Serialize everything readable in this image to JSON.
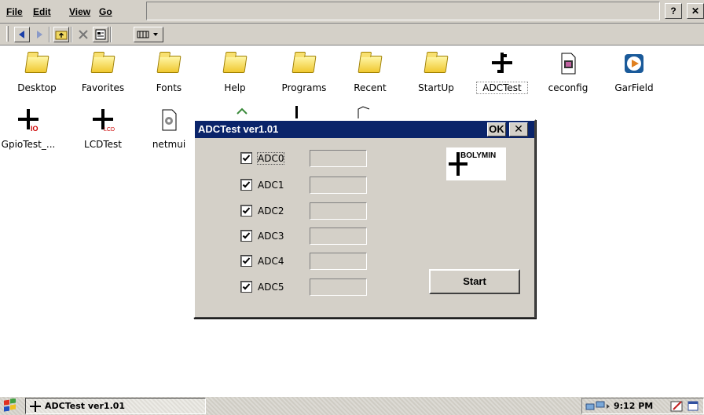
{
  "menubar": {
    "items": [
      "File",
      "Edit",
      "View",
      "Go"
    ],
    "help_label": "?",
    "close_label": "✕"
  },
  "toolbar": {
    "buttons": [
      "back-icon",
      "forward-icon",
      "up-folder-icon",
      "delete-icon",
      "properties-icon",
      "views-icon"
    ]
  },
  "desktop": {
    "icons": [
      {
        "label": "Desktop",
        "icon": "folder-icon"
      },
      {
        "label": "Favorites",
        "icon": "folder-icon"
      },
      {
        "label": "Fonts",
        "icon": "folder-icon"
      },
      {
        "label": "Help",
        "icon": "folder-icon"
      },
      {
        "label": "Programs",
        "icon": "folder-icon"
      },
      {
        "label": "Recent",
        "icon": "folder-icon"
      },
      {
        "label": "StartUp",
        "icon": "folder-icon"
      },
      {
        "label": "ADCTest",
        "icon": "adc-app-icon"
      },
      {
        "label": "ceconfig",
        "icon": "config-file-icon"
      },
      {
        "label": "GarField",
        "icon": "garfield-app-icon"
      },
      {
        "label": "GpioTest_...",
        "icon": "gpio-app-icon"
      },
      {
        "label": "LCDTest",
        "icon": "lcd-app-icon"
      },
      {
        "label": "netmui",
        "icon": "netmui-app-icon"
      }
    ]
  },
  "dialog": {
    "title": "ADCTest ver1.01",
    "ok_label": "OK",
    "close_label": "✕",
    "channels": [
      {
        "label": "ADC0",
        "checked": true,
        "value": ""
      },
      {
        "label": "ADC1",
        "checked": true,
        "value": ""
      },
      {
        "label": "ADC2",
        "checked": true,
        "value": ""
      },
      {
        "label": "ADC3",
        "checked": true,
        "value": ""
      },
      {
        "label": "ADC4",
        "checked": true,
        "value": ""
      },
      {
        "label": "ADC5",
        "checked": true,
        "value": ""
      }
    ],
    "logo_text": "BOLYMIN",
    "start_label": "Start"
  },
  "taskbar": {
    "task_label": "ADCTest ver1.01",
    "clock": "9:12 PM"
  },
  "colors": {
    "face": "#d4d0c8",
    "title_bar": "#0a246a",
    "folder": "#f0c830"
  }
}
